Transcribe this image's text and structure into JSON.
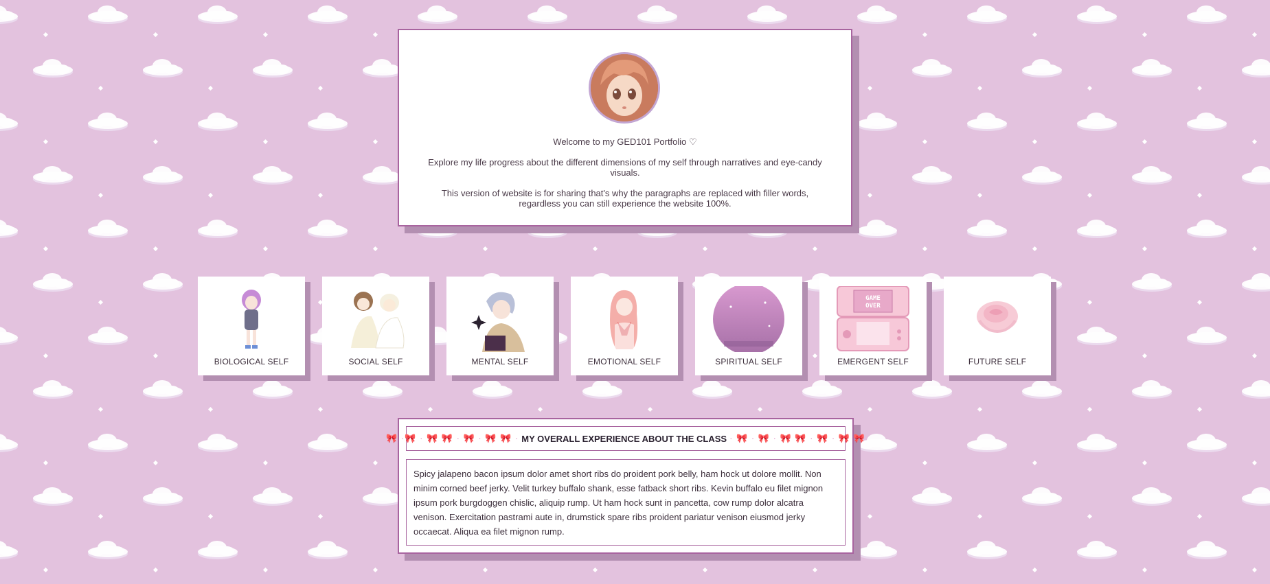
{
  "intro": {
    "welcome": "Welcome to my GED101 Portfolio ♡",
    "explore": "Explore my life progress about the different dimensions of my self through narratives and eye-candy visuals.",
    "note": "This version of website is for sharing that's why the paragraphs are replaced with filler words, regardless you can still experience the website 100%.",
    "avatar_icon": "anime-girl-avatar-icon"
  },
  "tiles": [
    {
      "label": "BIOLOGICAL SELF"
    },
    {
      "label": "SOCIAL SELF"
    },
    {
      "label": "MENTAL SELF"
    },
    {
      "label": "EMOTIONAL SELF"
    },
    {
      "label": "SPIRITUAL SELF"
    },
    {
      "label": "EMERGENT SELF"
    },
    {
      "label": "FUTURE SELF"
    }
  ],
  "console_screen_text": "GAME OVER",
  "experience": {
    "bows_left": "🎀 ·🎀 · 🎀 🎀 · 🎀 · 🎀 🎀 ·",
    "title": "MY OVERALL EXPERIENCE ABOUT THE CLASS",
    "bows_right": "· 🎀 · 🎀 · 🎀 🎀 · 🎀 · 🎀 🎀",
    "body": "Spicy jalapeno bacon ipsum dolor amet short ribs do proident pork belly, ham hock ut dolore mollit. Non minim corned beef jerky. Velit turkey buffalo shank, esse fatback short ribs. Kevin buffalo eu filet mignon ipsum pork burgdoggen chislic, aliquip rump. Ut ham hock sunt in pancetta, cow rump dolor alcatra venison. Exercitation pastrami aute in, drumstick spare ribs proident pariatur venison eiusmod jerky occaecat. Aliqua ea filet mignon rump."
  },
  "colors": {
    "background": "#e3c2de",
    "border": "#a8649f",
    "shadow": "#b38fb1",
    "accent_pink": "#e29ac8"
  }
}
